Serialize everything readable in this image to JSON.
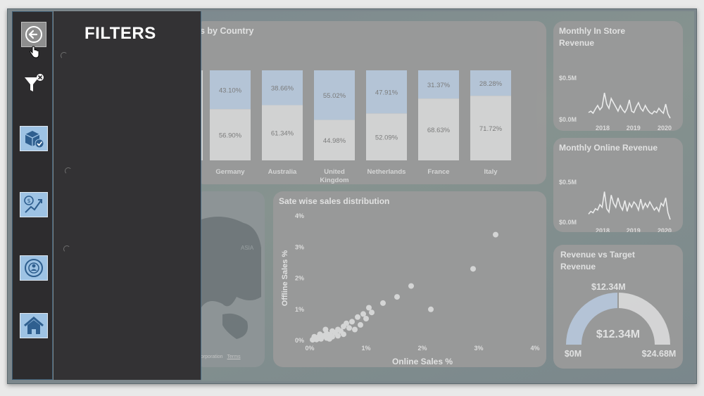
{
  "filters_panel": {
    "title": "FILTERS"
  },
  "country_chart": {
    "title": "s by Country",
    "series_colors": {
      "top": "#b7c7da",
      "bottom": "#d6d6d6"
    }
  },
  "chart_data": [
    {
      "type": "bar",
      "title": "s by Country",
      "categories": [
        "",
        "Germany",
        "Australia",
        "United Kingdom",
        "Netherlands",
        "France",
        "Italy"
      ],
      "category_lines": [
        [
          ""
        ],
        [
          "Germany"
        ],
        [
          "Australia"
        ],
        [
          "United",
          "Kingdom"
        ],
        [
          "Netherlands"
        ],
        [
          "France"
        ],
        [
          "Italy"
        ]
      ],
      "stacked_percent": true,
      "series": [
        {
          "values": [
            null,
            43.1,
            38.66,
            55.02,
            47.91,
            31.37,
            28.28
          ],
          "labels": [
            "",
            "43.10%",
            "38.66%",
            "55.02%",
            "47.91%",
            "31.37%",
            "28.28%"
          ]
        },
        {
          "values": [
            null,
            56.9,
            61.34,
            44.98,
            52.09,
            68.63,
            71.72
          ],
          "labels": [
            "",
            "56.90%",
            "61.34%",
            "44.98%",
            "52.09%",
            "68.63%",
            "71.72%"
          ]
        }
      ]
    },
    {
      "type": "line",
      "title": "Monthly In Store Revenue",
      "y_ticks": [
        "$0.5M",
        "$0.0M"
      ],
      "x_ticks": [
        "2018",
        "2019",
        "2020"
      ],
      "ylim": [
        0,
        0.6
      ],
      "y": [
        0.1,
        0.12,
        0.09,
        0.15,
        0.2,
        0.14,
        0.18,
        0.38,
        0.22,
        0.16,
        0.3,
        0.24,
        0.18,
        0.12,
        0.2,
        0.14,
        0.1,
        0.16,
        0.28,
        0.12,
        0.1,
        0.18,
        0.24,
        0.16,
        0.12,
        0.2,
        0.14,
        0.1,
        0.08,
        0.12,
        0.1,
        0.16,
        0.12,
        0.09,
        0.22,
        0.08,
        0.02
      ]
    },
    {
      "type": "line",
      "title": "Monthly Online Revenue",
      "y_ticks": [
        "$0.5M",
        "$0.0M"
      ],
      "x_ticks": [
        "2018",
        "2019",
        "2020"
      ],
      "ylim": [
        0,
        0.6
      ],
      "y": [
        0.12,
        0.16,
        0.14,
        0.2,
        0.18,
        0.26,
        0.22,
        0.45,
        0.2,
        0.15,
        0.4,
        0.28,
        0.22,
        0.36,
        0.24,
        0.18,
        0.32,
        0.16,
        0.28,
        0.22,
        0.3,
        0.26,
        0.18,
        0.34,
        0.2,
        0.28,
        0.22,
        0.3,
        0.24,
        0.18,
        0.22,
        0.16,
        0.28,
        0.24,
        0.36,
        0.14,
        0.04
      ]
    },
    {
      "type": "scatter",
      "title": "Sate wise sales distribution",
      "xlabel": "Online Sales %",
      "ylabel": "Offline Sales %",
      "x_ticks": [
        "0%",
        "1%",
        "2%",
        "3%",
        "4%"
      ],
      "y_ticks": [
        "4%",
        "3%",
        "2%",
        "1%",
        "0%"
      ],
      "xlim": [
        0,
        4
      ],
      "ylim": [
        0,
        4
      ],
      "points": [
        [
          3.3,
          3.4
        ],
        [
          2.9,
          2.3
        ],
        [
          1.8,
          1.75
        ],
        [
          1.55,
          1.4
        ],
        [
          2.15,
          1.0
        ],
        [
          1.3,
          1.2
        ],
        [
          1.05,
          1.05
        ],
        [
          0.95,
          0.85
        ],
        [
          1.1,
          0.9
        ],
        [
          0.85,
          0.75
        ],
        [
          1.0,
          0.7
        ],
        [
          0.75,
          0.6
        ],
        [
          0.65,
          0.55
        ],
        [
          0.9,
          0.5
        ],
        [
          0.6,
          0.45
        ],
        [
          0.7,
          0.4
        ],
        [
          0.5,
          0.35
        ],
        [
          0.55,
          0.3
        ],
        [
          0.4,
          0.3
        ],
        [
          0.45,
          0.25
        ],
        [
          0.3,
          0.22
        ],
        [
          0.35,
          0.18
        ],
        [
          0.25,
          0.15
        ],
        [
          0.2,
          0.12
        ],
        [
          0.15,
          0.1
        ],
        [
          0.1,
          0.08
        ],
        [
          0.2,
          0.05
        ],
        [
          0.3,
          0.08
        ],
        [
          0.12,
          0.03
        ],
        [
          0.05,
          0.02
        ],
        [
          0.4,
          0.12
        ],
        [
          0.6,
          0.2
        ],
        [
          0.8,
          0.35
        ],
        [
          0.28,
          0.35
        ],
        [
          0.5,
          0.15
        ],
        [
          0.18,
          0.2
        ],
        [
          0.08,
          0.12
        ],
        [
          0.35,
          0.05
        ]
      ]
    },
    {
      "type": "pie",
      "title": "Revenue vs Target Revenue",
      "gauge": true,
      "value": 12.34,
      "min": 0,
      "max": 24.68,
      "target_label": "$12.34M",
      "value_label": "$12.34M",
      "min_label": "$0M",
      "max_label": "$24.68M",
      "colors": {
        "fill": "#b7c7da",
        "rest": "#d9d9d9"
      }
    }
  ],
  "map_card": {
    "title_fragment": "y",
    "region_label": "ASIA",
    "attribution": "Corporation",
    "terms": "Terms"
  },
  "icons": [
    "back-arrow-icon",
    "clear-filter-icon",
    "product-check-icon",
    "sales-growth-icon",
    "customer-target-icon",
    "home-icon"
  ]
}
